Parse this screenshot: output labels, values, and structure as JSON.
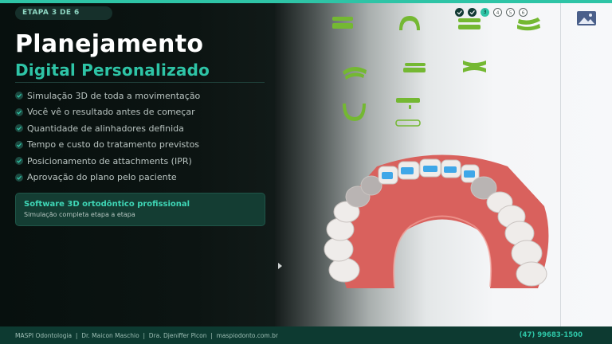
{
  "step_badge": "ETAPA 3 DE 6",
  "title_line1": "Planejamento",
  "title_line2": "Digital Personalizado",
  "benefits": [
    "Simulação 3D de toda a movimentação",
    "Você vê o resultado antes de começar",
    "Quantidade de alinhadores definida",
    "Tempo e custo do tratamento previstos",
    "Posicionamento de attachments (IPR)",
    "Aprovação do plano pelo paciente"
  ],
  "info_card": {
    "title": "Software 3D ortodôntico profissional",
    "subtitle": "Simulação completa etapa a etapa"
  },
  "step_progress": {
    "current": 3,
    "total": 6,
    "steps": [
      {
        "label": "",
        "state": "done"
      },
      {
        "label": "",
        "state": "done"
      },
      {
        "label": "3",
        "state": "active"
      },
      {
        "label": "4",
        "state": "todo"
      },
      {
        "label": "5",
        "state": "todo"
      },
      {
        "label": "6",
        "state": "todo"
      }
    ]
  },
  "footer": {
    "clinic": "MASPI Odontologia",
    "doctor1": "Dr. Maicon Maschio",
    "doctor2": "Dra. Djeniffer Picon",
    "website": "maspiodonto.com.br",
    "separator": "|",
    "phone": "(47) 99683-1500"
  },
  "colors": {
    "accent": "#2ec4a6",
    "panel_bg": "#0b1412",
    "footer_bg": "#0d3a31",
    "aligner_green": "#74b832",
    "gum": "#d9615d",
    "attachment_blue": "#3fa7e8"
  },
  "icons": {
    "check": "check-circle-icon",
    "image_button": "image-icon",
    "aligner_shapes": "aligner-piece-icon"
  }
}
